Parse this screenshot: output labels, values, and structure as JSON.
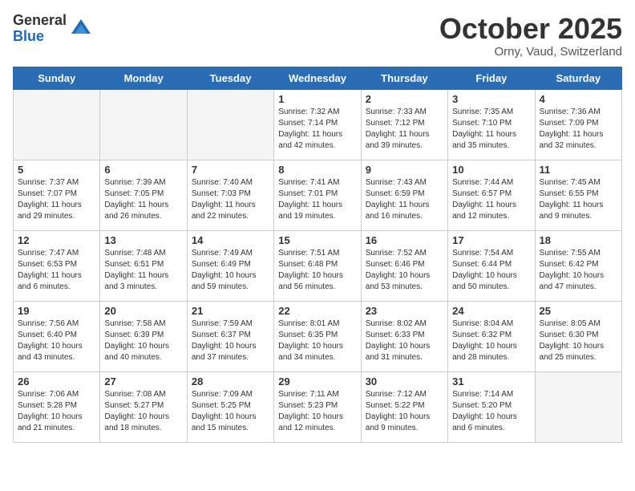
{
  "header": {
    "logo_general": "General",
    "logo_blue": "Blue",
    "month": "October 2025",
    "location": "Orny, Vaud, Switzerland"
  },
  "days_of_week": [
    "Sunday",
    "Monday",
    "Tuesday",
    "Wednesday",
    "Thursday",
    "Friday",
    "Saturday"
  ],
  "weeks": [
    [
      {
        "day": "",
        "info": "",
        "empty": true
      },
      {
        "day": "",
        "info": "",
        "empty": true
      },
      {
        "day": "",
        "info": "",
        "empty": true
      },
      {
        "day": "1",
        "info": "Sunrise: 7:32 AM\nSunset: 7:14 PM\nDaylight: 11 hours\nand 42 minutes.",
        "empty": false
      },
      {
        "day": "2",
        "info": "Sunrise: 7:33 AM\nSunset: 7:12 PM\nDaylight: 11 hours\nand 39 minutes.",
        "empty": false
      },
      {
        "day": "3",
        "info": "Sunrise: 7:35 AM\nSunset: 7:10 PM\nDaylight: 11 hours\nand 35 minutes.",
        "empty": false
      },
      {
        "day": "4",
        "info": "Sunrise: 7:36 AM\nSunset: 7:09 PM\nDaylight: 11 hours\nand 32 minutes.",
        "empty": false
      }
    ],
    [
      {
        "day": "5",
        "info": "Sunrise: 7:37 AM\nSunset: 7:07 PM\nDaylight: 11 hours\nand 29 minutes.",
        "empty": false
      },
      {
        "day": "6",
        "info": "Sunrise: 7:39 AM\nSunset: 7:05 PM\nDaylight: 11 hours\nand 26 minutes.",
        "empty": false
      },
      {
        "day": "7",
        "info": "Sunrise: 7:40 AM\nSunset: 7:03 PM\nDaylight: 11 hours\nand 22 minutes.",
        "empty": false
      },
      {
        "day": "8",
        "info": "Sunrise: 7:41 AM\nSunset: 7:01 PM\nDaylight: 11 hours\nand 19 minutes.",
        "empty": false
      },
      {
        "day": "9",
        "info": "Sunrise: 7:43 AM\nSunset: 6:59 PM\nDaylight: 11 hours\nand 16 minutes.",
        "empty": false
      },
      {
        "day": "10",
        "info": "Sunrise: 7:44 AM\nSunset: 6:57 PM\nDaylight: 11 hours\nand 12 minutes.",
        "empty": false
      },
      {
        "day": "11",
        "info": "Sunrise: 7:45 AM\nSunset: 6:55 PM\nDaylight: 11 hours\nand 9 minutes.",
        "empty": false
      }
    ],
    [
      {
        "day": "12",
        "info": "Sunrise: 7:47 AM\nSunset: 6:53 PM\nDaylight: 11 hours\nand 6 minutes.",
        "empty": false
      },
      {
        "day": "13",
        "info": "Sunrise: 7:48 AM\nSunset: 6:51 PM\nDaylight: 11 hours\nand 3 minutes.",
        "empty": false
      },
      {
        "day": "14",
        "info": "Sunrise: 7:49 AM\nSunset: 6:49 PM\nDaylight: 10 hours\nand 59 minutes.",
        "empty": false
      },
      {
        "day": "15",
        "info": "Sunrise: 7:51 AM\nSunset: 6:48 PM\nDaylight: 10 hours\nand 56 minutes.",
        "empty": false
      },
      {
        "day": "16",
        "info": "Sunrise: 7:52 AM\nSunset: 6:46 PM\nDaylight: 10 hours\nand 53 minutes.",
        "empty": false
      },
      {
        "day": "17",
        "info": "Sunrise: 7:54 AM\nSunset: 6:44 PM\nDaylight: 10 hours\nand 50 minutes.",
        "empty": false
      },
      {
        "day": "18",
        "info": "Sunrise: 7:55 AM\nSunset: 6:42 PM\nDaylight: 10 hours\nand 47 minutes.",
        "empty": false
      }
    ],
    [
      {
        "day": "19",
        "info": "Sunrise: 7:56 AM\nSunset: 6:40 PM\nDaylight: 10 hours\nand 43 minutes.",
        "empty": false
      },
      {
        "day": "20",
        "info": "Sunrise: 7:58 AM\nSunset: 6:39 PM\nDaylight: 10 hours\nand 40 minutes.",
        "empty": false
      },
      {
        "day": "21",
        "info": "Sunrise: 7:59 AM\nSunset: 6:37 PM\nDaylight: 10 hours\nand 37 minutes.",
        "empty": false
      },
      {
        "day": "22",
        "info": "Sunrise: 8:01 AM\nSunset: 6:35 PM\nDaylight: 10 hours\nand 34 minutes.",
        "empty": false
      },
      {
        "day": "23",
        "info": "Sunrise: 8:02 AM\nSunset: 6:33 PM\nDaylight: 10 hours\nand 31 minutes.",
        "empty": false
      },
      {
        "day": "24",
        "info": "Sunrise: 8:04 AM\nSunset: 6:32 PM\nDaylight: 10 hours\nand 28 minutes.",
        "empty": false
      },
      {
        "day": "25",
        "info": "Sunrise: 8:05 AM\nSunset: 6:30 PM\nDaylight: 10 hours\nand 25 minutes.",
        "empty": false
      }
    ],
    [
      {
        "day": "26",
        "info": "Sunrise: 7:06 AM\nSunset: 5:28 PM\nDaylight: 10 hours\nand 21 minutes.",
        "empty": false
      },
      {
        "day": "27",
        "info": "Sunrise: 7:08 AM\nSunset: 5:27 PM\nDaylight: 10 hours\nand 18 minutes.",
        "empty": false
      },
      {
        "day": "28",
        "info": "Sunrise: 7:09 AM\nSunset: 5:25 PM\nDaylight: 10 hours\nand 15 minutes.",
        "empty": false
      },
      {
        "day": "29",
        "info": "Sunrise: 7:11 AM\nSunset: 5:23 PM\nDaylight: 10 hours\nand 12 minutes.",
        "empty": false
      },
      {
        "day": "30",
        "info": "Sunrise: 7:12 AM\nSunset: 5:22 PM\nDaylight: 10 hours\nand 9 minutes.",
        "empty": false
      },
      {
        "day": "31",
        "info": "Sunrise: 7:14 AM\nSunset: 5:20 PM\nDaylight: 10 hours\nand 6 minutes.",
        "empty": false
      },
      {
        "day": "",
        "info": "",
        "empty": true
      }
    ]
  ]
}
